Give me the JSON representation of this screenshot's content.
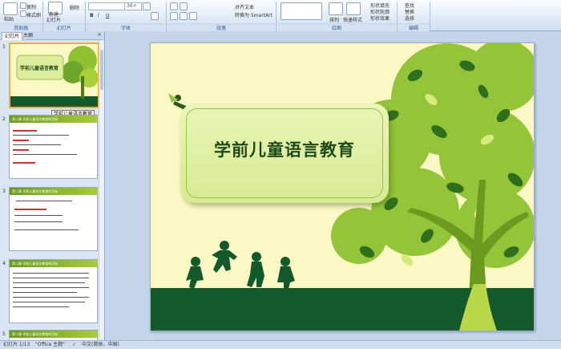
{
  "ribbon": {
    "clipboard": {
      "paste": "粘贴",
      "copy": "复制",
      "format_painter": "格式刷",
      "group": "剪贴板"
    },
    "slides": {
      "new_slide": "新建",
      "new_slide2": "幻灯片",
      "delete": "删除",
      "group": "幻灯片"
    },
    "font": {
      "size": "36+",
      "group": "字体"
    },
    "paragraph": {
      "text_direction": "对齐文本",
      "smartart": "转换为 SmartArt",
      "group": "段落"
    },
    "drawing": {
      "arrange": "排列",
      "quick_styles": "快速样式",
      "fill": "形状填充",
      "outline": "形状轮廓",
      "effects": "形状效果",
      "group": "绘图"
    },
    "editing": {
      "find": "查找",
      "replace": "替换",
      "select": "选择",
      "group": "编辑"
    }
  },
  "pane": {
    "tab_slides": "幻灯片",
    "tab_outline": "大纲",
    "close": "×",
    "tooltip": "学前儿童语言教育",
    "thumbs": [
      {
        "num": "1",
        "title": "学前儿童语言教育"
      },
      {
        "num": "2",
        "header": "第二章 学前儿童语言教育的目标"
      },
      {
        "num": "3",
        "header": "第二章 学前儿童语言教育的目标"
      },
      {
        "num": "4",
        "header": "第二章 学前儿童语言教育的目标"
      },
      {
        "num": "5",
        "header": "第二章 学前儿童语言教育的目标"
      }
    ]
  },
  "slide": {
    "title": "学前儿童语言教育"
  },
  "status": {
    "slide": "幻灯片 1/13",
    "theme": "\"Office 主题\"",
    "lang": "中文(中国)",
    "ime": "中文(简体，中国)"
  },
  "colors": {
    "ground": "#14592b",
    "leaf_dark": "#2f6f1c",
    "leaf_light": "#a6cf3a",
    "background": "#fbf8c6"
  }
}
